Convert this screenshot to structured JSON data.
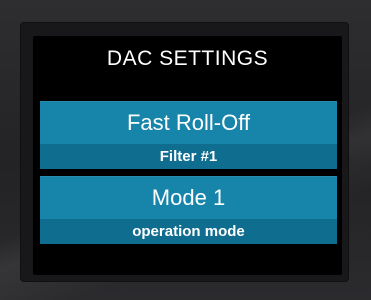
{
  "header": {
    "title": "DAC SETTINGS"
  },
  "settings": [
    {
      "value": "Fast Roll-Off",
      "caption": "Filter #1"
    },
    {
      "value": "Mode 1",
      "caption": "operation mode"
    }
  ],
  "colors": {
    "tile_primary": "#1784aa",
    "tile_secondary": "#0f6e8f",
    "screen_background": "#000000",
    "text": "#ffffff"
  }
}
